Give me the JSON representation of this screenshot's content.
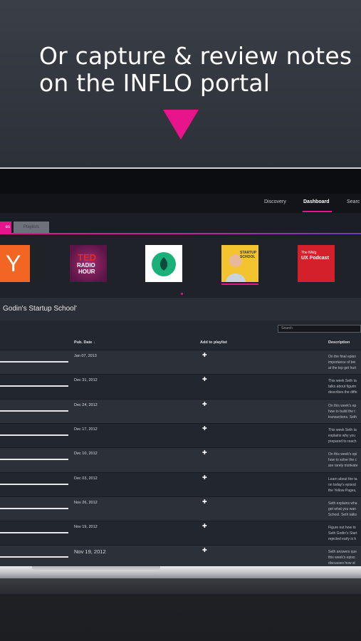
{
  "headline": {
    "line1": "Or capture & review notes",
    "line2": "on the INFLO portal"
  },
  "nav": {
    "items": [
      "Discovery",
      "Dashboard",
      "Searc"
    ],
    "active": "Dashboard"
  },
  "tabs": {
    "active_label": "es",
    "inactive_label": "Playlists"
  },
  "podcast_title": "Godin's Startup School'",
  "search_placeholder": "Search",
  "table": {
    "headers": {
      "pub_date": "Pub. Date",
      "add_to_playlist": "Add to playlist",
      "description": "Description"
    },
    "rows": [
      {
        "date": "Jan 07, 2013",
        "desc": [
          "On the final episo",
          "importance of bei",
          "at the top get hurt"
        ]
      },
      {
        "date": "Dec 31, 2012",
        "desc": [
          "This week Seth ta",
          "talks about figurin",
          "describes the diffe"
        ]
      },
      {
        "date": "Dec 24, 2012",
        "desc": [
          "On this week's ep",
          "how to build the t",
          "transactions. Seth"
        ]
      },
      {
        "date": "Dec 17, 2012",
        "desc": [
          "This week Seth ta",
          "explains why you",
          "prepared to reach"
        ]
      },
      {
        "date": "Dec 10, 2012",
        "desc": [
          "On this week's epi",
          "how to solve the c",
          "are rarely motivate"
        ]
      },
      {
        "date": "Dec 03, 2012",
        "desc": [
          "Learn about the ta",
          "on today's episod",
          "the Yellow Pages,"
        ]
      },
      {
        "date": "Nov 26, 2012",
        "desc": [
          "Seth explains wha",
          "get what you wan",
          "School. Seth talks"
        ]
      },
      {
        "date": "Nov 19, 2012",
        "desc": [
          "Figure out how to",
          "Seth Godin's Start",
          "rejected early is h"
        ]
      },
      {
        "date": "Nov 19, 2012",
        "desc": [
          "Seth answers que",
          "this week's episo",
          "discusses how st"
        ]
      }
    ]
  },
  "tiles": [
    {
      "name": "y-combinator",
      "text": "Y",
      "color": "#f26522"
    },
    {
      "name": "ted-radio-hour",
      "text_top": "TED",
      "text_mid": "RADIO",
      "text_bot": "HOUR",
      "color": "#7a1f5c"
    },
    {
      "name": "green-leaf",
      "color": "#ffffff"
    },
    {
      "name": "startup-school",
      "text": "STARTUP SCHOOL",
      "color": "#f4c430"
    },
    {
      "name": "nng-ux-podcast",
      "text_top": "The NN/g",
      "text_mid": "UX Podcast",
      "color": "#d4202a"
    }
  ],
  "colors": {
    "accent": "#e8148c"
  }
}
